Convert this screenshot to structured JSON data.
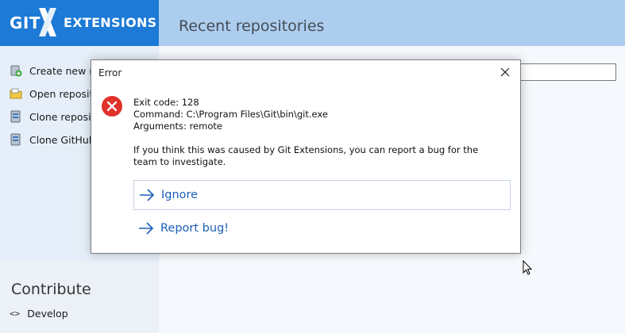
{
  "brand": {
    "git": "GIT",
    "extensions": "EXTENSIONS"
  },
  "sidebar": {
    "items": [
      {
        "label": "Create new rep",
        "icon": "create-repo-icon"
      },
      {
        "label": "Open repositor",
        "icon": "open-folder-icon"
      },
      {
        "label": "Clone reposito",
        "icon": "clone-repo-icon"
      },
      {
        "label": "Clone GitHub r",
        "icon": "clone-github-icon"
      }
    ],
    "contribute_heading": "Contribute",
    "develop_icon": "<>",
    "develop_label": "Develop"
  },
  "header": {
    "title": "Recent repositories"
  },
  "dialog": {
    "title": "Error",
    "exit_code": "Exit code: 128",
    "command": "Command: C:\\Program Files\\Git\\bin\\git.exe",
    "arguments": "Arguments: remote",
    "message": "If you think this was caused by Git Extensions, you can report a bug for the team to investigate.",
    "ignore_label": "Ignore",
    "report_label": "Report bug!"
  },
  "colors": {
    "brand_blue": "#1d7ad6",
    "header_blue": "#adcdee",
    "link_blue": "#1c5fb8",
    "error_red": "#e0312a"
  }
}
